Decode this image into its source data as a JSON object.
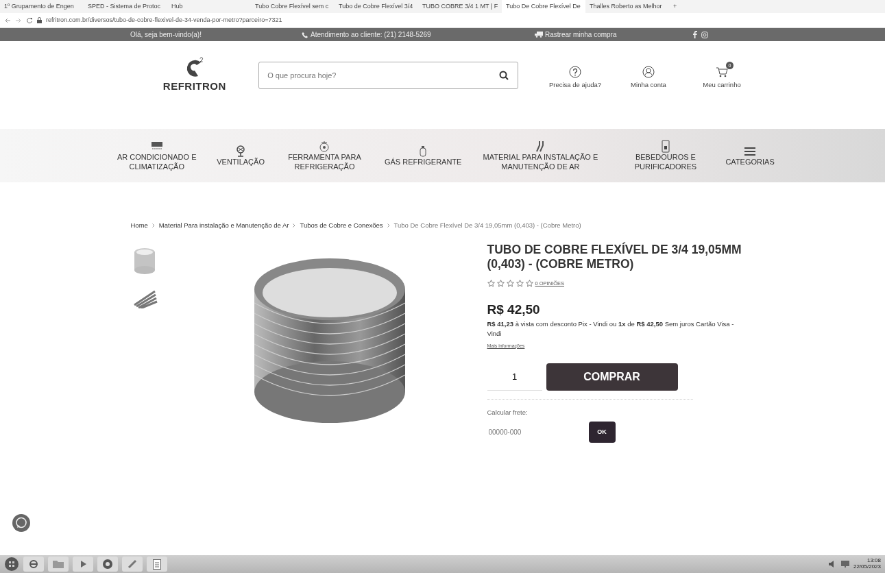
{
  "browser": {
    "tabs": [
      {
        "title": "1º Grupamento de Engen",
        "selected": false
      },
      {
        "title": "SPED - Sistema de Protoc",
        "selected": false
      },
      {
        "title": "Hub",
        "selected": false
      },
      {
        "title": "Tubo Cobre Flexível sem c",
        "selected": false
      },
      {
        "title": "Tubo de Cobre Flexível 3/4",
        "selected": false
      },
      {
        "title": "TUBO COBRE 3/4 1 MT | F",
        "selected": false
      },
      {
        "title": "Tubo De Cobre Flexível De",
        "selected": true
      },
      {
        "title": "Thalles Roberto as Melhor",
        "selected": false
      }
    ],
    "new_tab": "+",
    "url": "refritron.com.br/diversos/tubo-de-cobre-flexivel-de-34-venda-por-metro?parceiro=7321"
  },
  "top_bar": {
    "greeting": "Olá, seja bem-vindo(a)!",
    "support": "Atendimento ao cliente: (21) 2148-5269",
    "tracking": "Rastrear minha compra"
  },
  "header": {
    "logo": "REFRITRON",
    "search": {
      "placeholder": "O que procura hoje?"
    },
    "actions": [
      {
        "kind": "help",
        "label": "Precisa de ajuda?"
      },
      {
        "kind": "account",
        "label": "Minha conta"
      },
      {
        "kind": "cart",
        "label": "Meu carrinho",
        "count": "0"
      }
    ]
  },
  "categories": [
    {
      "kind": "ac",
      "label": "AR CONDICIONADO E CLIMATIZAÇÃO"
    },
    {
      "kind": "fan",
      "label": "VENTILAÇÃO"
    },
    {
      "kind": "tools",
      "label": "FERRAMENTA PARA REFRIGERAÇÃO"
    },
    {
      "kind": "gas",
      "label": "GÁS REFRIGERANTE"
    },
    {
      "kind": "pipe",
      "label": "MATERIAL PARA INSTALAÇÃO E MANUTENÇÃO DE AR"
    },
    {
      "kind": "dispenser",
      "label": "BEBEDOUROS E PURIFICADORES"
    },
    {
      "kind": "menu",
      "label": "CATEGORIAS"
    }
  ],
  "breadcrumb": [
    "Home",
    "Material Para instalação e Manutenção de Ar",
    "Tubos de Cobre e Conexões",
    "Tubo De Cobre Flexível De 3/4 19,05mm (0,403) - (Cobre Metro)"
  ],
  "product": {
    "title": "TUBO DE COBRE FLEXÍVEL DE 3/4 19,05MM (0,403) - (COBRE METRO)",
    "stars": 0,
    "reviews": "0 OPINIÕES",
    "price": "R$ 42,50",
    "price_details": "**R$ 41,23** à vista com desconto Pix - Vindi ou **1x** de **R$ 42,50** Sem juros Cartão Visa - Vindi",
    "more_info": "Mais informações",
    "quantity": "1",
    "buy_button": "COMPRAR",
    "shipping_label": "Calcular frete:",
    "zip": {
      "placeholder": "00000-000"
    },
    "ok_button": "OK"
  },
  "taskbar": {
    "time": "13:08",
    "date": "22/05/2023"
  }
}
